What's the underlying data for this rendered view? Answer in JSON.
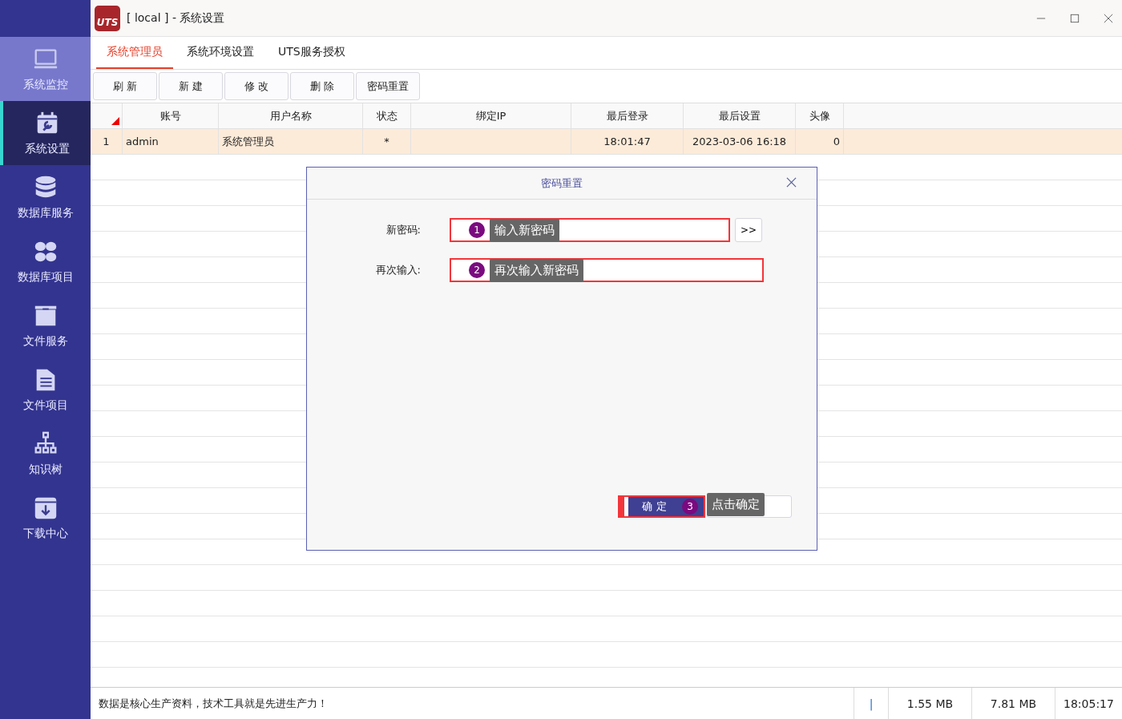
{
  "window": {
    "title": "[ local ] - 系统设置",
    "logo_text": "UTS"
  },
  "sidebar": {
    "items": [
      {
        "label": "系统监控",
        "selected": false,
        "hovered": true
      },
      {
        "label": "系统设置",
        "selected": true,
        "hovered": false
      },
      {
        "label": "数据库服务",
        "selected": false,
        "hovered": false
      },
      {
        "label": "数据库项目",
        "selected": false,
        "hovered": false
      },
      {
        "label": "文件服务",
        "selected": false,
        "hovered": false
      },
      {
        "label": "文件项目",
        "selected": false,
        "hovered": false
      },
      {
        "label": "知识树",
        "selected": false,
        "hovered": false
      },
      {
        "label": "下载中心",
        "selected": false,
        "hovered": false
      }
    ]
  },
  "tabs": [
    {
      "label": "系统管理员",
      "selected": true
    },
    {
      "label": "系统环境设置",
      "selected": false
    },
    {
      "label": "UTS服务授权",
      "selected": false
    }
  ],
  "toolbar": [
    "刷 新",
    "新 建",
    "修 改",
    "删 除",
    "密码重置"
  ],
  "table": {
    "columns": [
      "账号",
      "用户名称",
      "状态",
      "绑定IP",
      "最后登录",
      "最后设置",
      "头像"
    ],
    "rows": [
      {
        "index": "1",
        "cells": [
          "admin",
          "系统管理员",
          "*",
          "",
          "18:01:47",
          "2023-03-06 16:18",
          "0"
        ],
        "selected": true
      }
    ]
  },
  "dialog": {
    "title": "密码重置",
    "fields": [
      {
        "label": "新密码:",
        "button": ">>",
        "highlighted": true,
        "annotation": {
          "number": "1",
          "text": "输入新密码"
        }
      },
      {
        "label": "再次输入:",
        "highlighted": true,
        "annotation": {
          "number": "2",
          "text": "再次输入新密码"
        }
      }
    ],
    "confirm": {
      "label": "确 定",
      "highlighted": true,
      "annotation": {
        "number": "3",
        "text": "点击确定"
      }
    }
  },
  "status_bar": {
    "message": "数据是核心生产资料，技术工具就是先进生产力！",
    "cursor": "|",
    "cells": [
      "1.55 MB",
      "7.81 MB",
      "18:05:17"
    ]
  }
}
